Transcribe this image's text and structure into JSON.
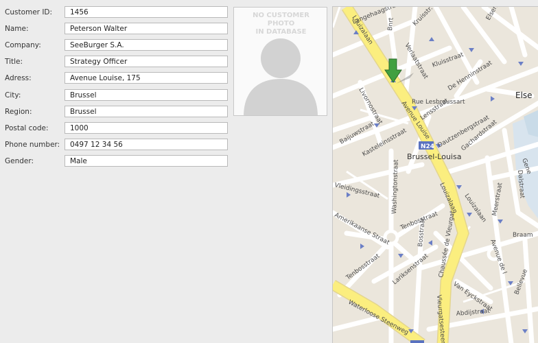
{
  "customer": {
    "fields": [
      {
        "label": "Customer ID:",
        "value": "1456"
      },
      {
        "label": "Name:",
        "value": "Peterson Walter"
      },
      {
        "label": "Company:",
        "value": "SeeBurger S.A."
      },
      {
        "label": "Title:",
        "value": "Strategy Officer"
      },
      {
        "label": "Adress:",
        "value": "Avenue Louise, 175"
      },
      {
        "label": "City:",
        "value": "Brussel"
      },
      {
        "label": "Region:",
        "value": "Brussel"
      },
      {
        "label": "Postal code:",
        "value": "1000"
      },
      {
        "label": "Phone number:",
        "value": "0497 12 34 56"
      },
      {
        "label": "Gender:",
        "value": "Male"
      }
    ]
  },
  "photo": {
    "placeholder_line1": "NO CUSTOMER PHOTO",
    "placeholder_line2": "IN DATABASE"
  },
  "map": {
    "district": "Brussel-Louisa",
    "route_shield": "N24",
    "place_label": "Else",
    "streets": {
      "langehaag": "Langehaagstraat",
      "kruiss": "Kruisstr.",
      "kluist": "Kluisstraat",
      "henninstraat": "De Henninstraat",
      "elsense": "Elsense Steenweg",
      "lesbroussart": "Rue Lesbroussart",
      "avenue_louise": "Avenue Louise",
      "louizalaan_top": "Louizalaan",
      "livorno": "Livornostraat",
      "baijuw": "Baijuwstraat",
      "kasteleins": "Kasteleinsstraat",
      "lens": "Lensstraat",
      "dautzenberg": "Dautzenbergstraat",
      "gachard": "Gachardstraat",
      "verlaat": "Verlaatstraat",
      "washington": "Washingtonstraat",
      "vleidings": "Vleidingsstraat",
      "amerikaanse": "Amerikaanse Straat",
      "tenbosch": "Tenbosstraat",
      "bosstraat": "Bosstraat",
      "larikens": "Lariksenstraat",
      "louizalaan_mid": "Louizalaan",
      "louizalaan_right": "Louizalaan",
      "meer": "Meerstraat",
      "dalstraat": "Dalstraat",
      "chaussee_vleurgat": "Chaussée de Vleurgat",
      "vleurgat": "Vleurgatsesteenw",
      "van_eyck": "Van Eyckstraat",
      "waterloose": "Waterloose Steenweg",
      "abdij": "Abdijstraat",
      "gene": "Gene",
      "braam": "Braam",
      "bellevue": "Bellevue",
      "avenue_de_l": "Avenue de l",
      "jourdan": "Bnrt"
    }
  }
}
